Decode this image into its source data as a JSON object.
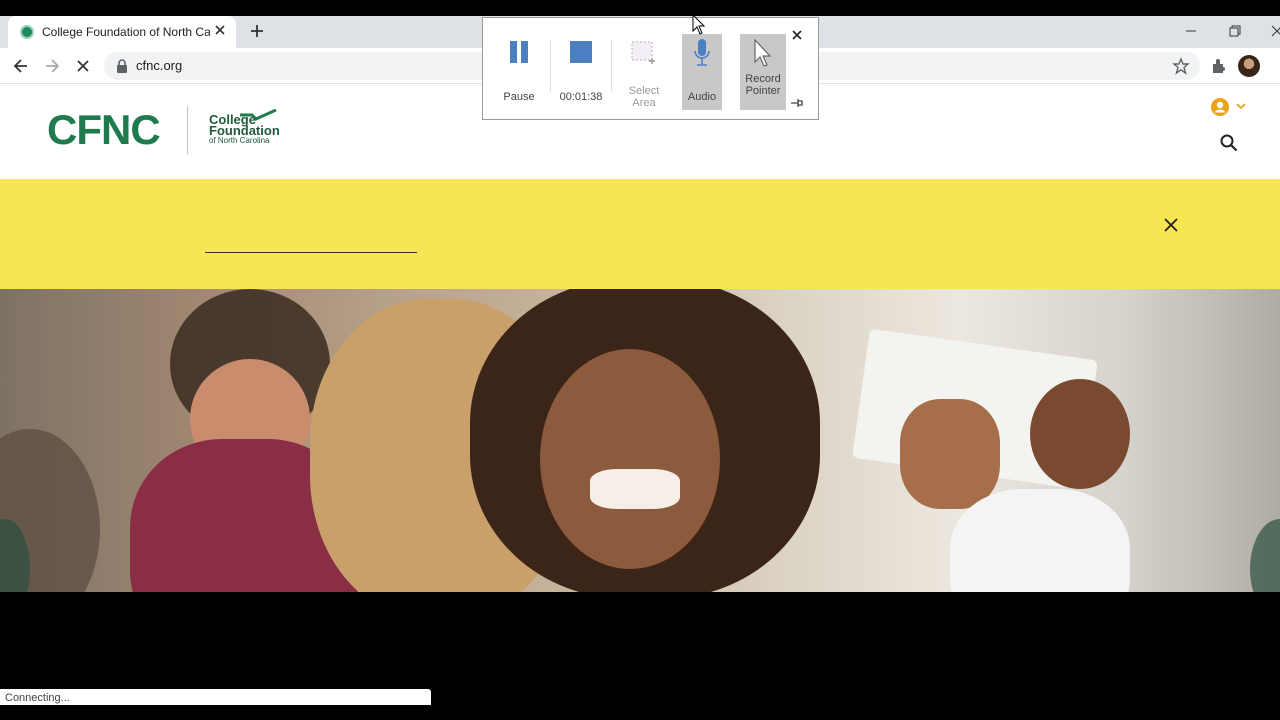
{
  "browser": {
    "tab_title": "College Foundation of North Car",
    "url": "cfnc.org"
  },
  "site": {
    "logo_main": "CFNC",
    "logo_line1": "College",
    "logo_line2": "Foundation",
    "logo_line3": "of North Carolina"
  },
  "hero": {
    "description_alt": "Students celebrating in a school hallway"
  },
  "recorder": {
    "pause_label": "Pause",
    "timer": "00:01:38",
    "select_area_label": "Select Area",
    "audio_label": "Audio",
    "record_pointer_label": "Record Pointer"
  },
  "status": {
    "text": "Connecting..."
  },
  "colors": {
    "brand_green": "#1f7a4d",
    "banner_yellow": "#f7e553",
    "account_orange": "#e8a317",
    "recorder_blue": "#4a7fc1"
  }
}
